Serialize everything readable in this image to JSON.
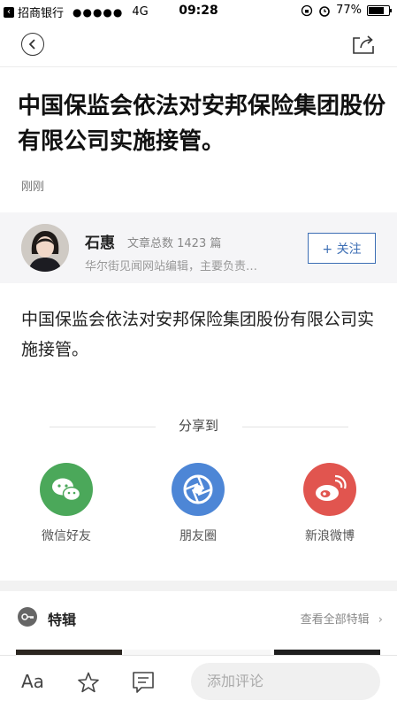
{
  "status_bar": {
    "carrier": "招商银行",
    "signal": "●●●●●",
    "network": "4G",
    "time": "09:28",
    "battery": "77%",
    "battery_level": 0.77
  },
  "article": {
    "title": "中国保监会依法对安邦保险集团股份有限公司实施接管。",
    "published": "刚刚",
    "body": "中国保监会依法对安邦保险集团股份有限公司实施接管。"
  },
  "author": {
    "name": "石惠",
    "stat": "文章总数  1423 篇",
    "description": "华尔街见闻网站编辑，主要负责…",
    "follow_label": "+ 关注"
  },
  "share": {
    "heading": "分享到",
    "items": [
      {
        "label": "微信好友",
        "icon": "wechat-icon",
        "color": "#4ba85a"
      },
      {
        "label": "朋友圈",
        "icon": "moments-icon",
        "color": "#4d86d6"
      },
      {
        "label": "新浪微博",
        "icon": "weibo-icon",
        "color": "#e1554f"
      }
    ]
  },
  "special": {
    "title": "特辑",
    "view_all": "查看全部特辑"
  },
  "bottom_bar": {
    "font_label": "Aa",
    "comment_placeholder": "添加评论"
  }
}
